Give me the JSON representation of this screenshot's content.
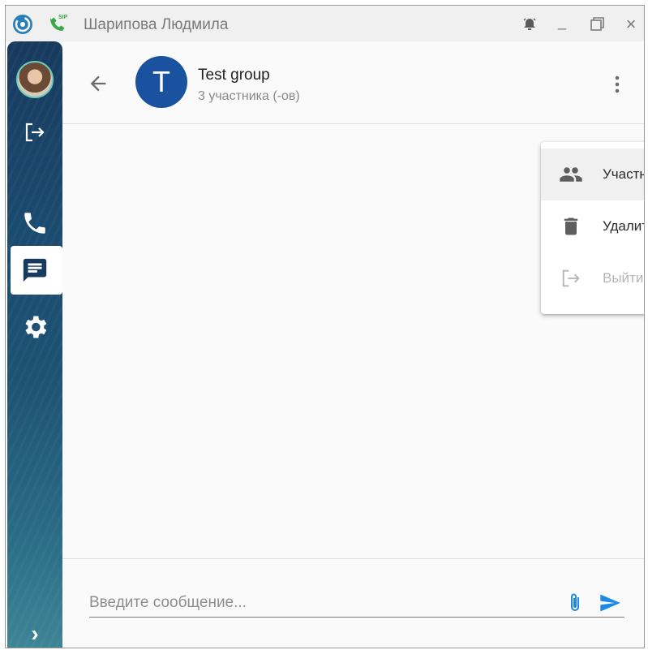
{
  "window": {
    "title": "Шарипова Людмила"
  },
  "titlebar": {
    "logo_icon": "app-logo-icon",
    "sip_icon": "sip-phone-icon",
    "sip_badge": "SIP",
    "alarm_icon": "alarm-icon",
    "minimize_label": "_",
    "maximize_icon": "maximize-icon",
    "close_label": "×"
  },
  "sidebar": {
    "items": [
      {
        "name": "avatar",
        "icon": "user-avatar"
      },
      {
        "name": "logout",
        "icon": "logout-icon"
      },
      {
        "name": "calls",
        "icon": "phone-icon"
      },
      {
        "name": "chats",
        "icon": "chat-icon",
        "active": true
      },
      {
        "name": "settings",
        "icon": "gear-icon"
      }
    ],
    "expand_label": "›"
  },
  "chat": {
    "group_initial": "T",
    "group_name": "Test group",
    "group_subtitle": "3 участника (-ов)",
    "avatar_color": "#1a52a0"
  },
  "menu": {
    "items": [
      {
        "label": "Участники",
        "icon": "people-icon",
        "enabled": true
      },
      {
        "label": "Удалить",
        "icon": "trash-icon",
        "enabled": true
      },
      {
        "label": "Выйти",
        "icon": "exit-icon",
        "enabled": false
      }
    ]
  },
  "composer": {
    "placeholder": "Введите сообщение...",
    "attach_icon": "paperclip-icon",
    "send_icon": "send-icon",
    "accent": "#1e88e5"
  }
}
